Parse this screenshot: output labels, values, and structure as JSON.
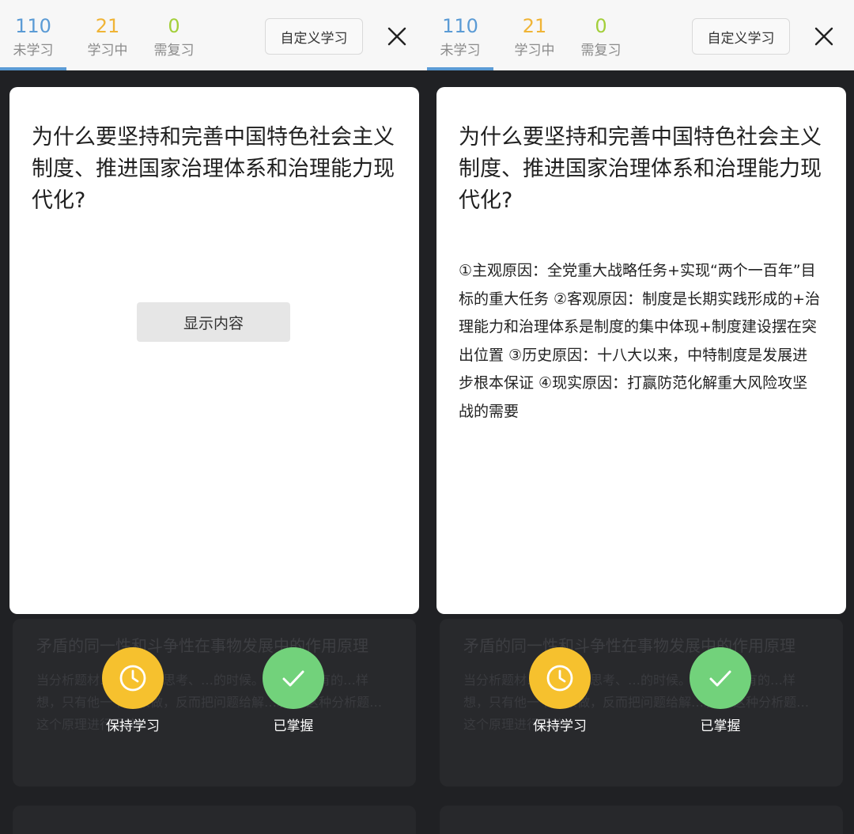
{
  "header": {
    "stats": [
      {
        "value": "110",
        "label": "未学习"
      },
      {
        "value": "21",
        "label": "学习中"
      },
      {
        "value": "0",
        "label": "需复习"
      }
    ],
    "custom_label": "自定义学习",
    "active_tab": "未学习"
  },
  "card": {
    "question": "为什么要坚持和完善中国特色社会主义制度、推进国家治理体系和治理能力现代化?",
    "show_label": "显示内容",
    "answer": "①主观原因：全党重大战略任务+实现“两个一百年”目标的重大任务 ②客观原因：制度是长期实践形成的+治理能力和治理体系是制度的集中体现+制度建设摆在突出位置 ③历史原因：十八大以来，中特制度是发展进步根本保证 ④现实原因：打赢防范化解重大风险攻坚战的需要"
  },
  "next_card": {
    "title": "矛盾的同一性和斗争性在事物发展中的作用原理",
    "body": "当分析题材…人公逆向思考、…的时候。eg：当所有的…样想，只有他一个…来做，反而把问题给解…况。 这种分析题…这个原理进行回答。"
  },
  "actions": {
    "keep_label": "保持学习",
    "done_label": "已掌握"
  },
  "colors": {
    "unlearned": "#5b9bd5",
    "learning": "#f0b436",
    "review": "#a3cf3a",
    "keep": "#f6c12e",
    "done": "#72d27b"
  }
}
